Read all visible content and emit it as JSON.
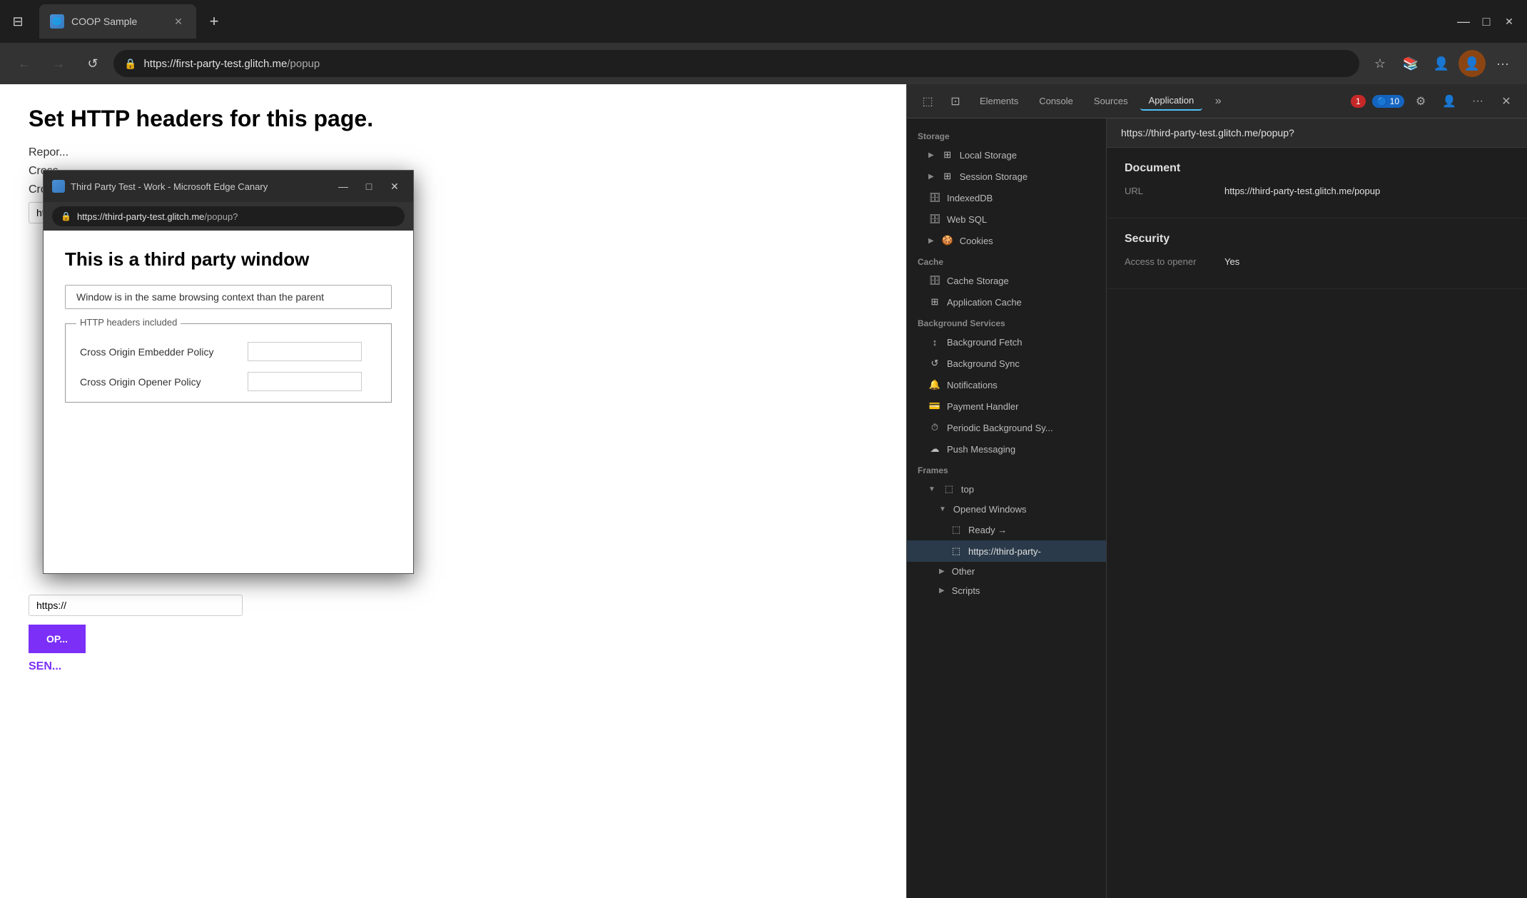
{
  "browser": {
    "tab_title": "COOP Sample",
    "tab_new_label": "+",
    "window_minimize": "—",
    "window_maximize": "□",
    "window_close": "✕",
    "nav_back": "←",
    "nav_forward": "→",
    "nav_reload": "↺",
    "address_protocol": "https://",
    "address_host": "first-party-test.glitch.me",
    "address_path": "/popup"
  },
  "page": {
    "title": "Set HTTP headers for this page.",
    "line1": "Repor...",
    "line2": "Cross...",
    "line3": "Cross...",
    "input_placeholder": "https://...",
    "button_label": "OP...",
    "send_label": "SEN..."
  },
  "popup": {
    "title": "Third Party Test - Work - Microsoft Edge Canary",
    "minimize": "—",
    "maximize": "□",
    "close": "✕",
    "address_protocol": "https://",
    "address_host": "third-party-test.glitch.me",
    "address_path": "/popup?",
    "heading": "This is a third party window",
    "info_box": "Window is in the same browsing context than the parent",
    "fieldset_legend": "HTTP headers included",
    "field1_label": "Cross Origin Embedder Policy",
    "field2_label": "Cross Origin Opener Policy",
    "field1_value": "",
    "field2_value": ""
  },
  "devtools": {
    "tool_inspector": "⬚",
    "tool_device": "⊡",
    "tabs": [
      {
        "label": "Elements",
        "active": false
      },
      {
        "label": "Console",
        "active": false
      },
      {
        "label": "Sources",
        "active": false
      },
      {
        "label": "Application",
        "active": true
      }
    ],
    "more_tabs": "»",
    "badge_red": "1",
    "badge_blue": "10",
    "gear": "⚙",
    "person": "👤",
    "ellipsis": "···",
    "close": "✕",
    "url_bar": "https://third-party-test.glitch.me/popup?",
    "sidebar": {
      "storage_label": "Storage",
      "local_storage": "Local Storage",
      "session_storage": "Session Storage",
      "indexed_db": "IndexedDB",
      "web_sql": "Web SQL",
      "cookies": "Cookies",
      "cache_label": "Cache",
      "cache_storage": "Cache Storage",
      "application_cache": "Application Cache",
      "background_services_label": "Background Services",
      "background_fetch": "Background Fetch",
      "background_sync": "Background Sync",
      "notifications": "Notifications",
      "payment_handler": "Payment Handler",
      "periodic_bg_sync": "Periodic Background Sy...",
      "push_messaging": "Push Messaging",
      "frames_label": "Frames",
      "frames_top": "top",
      "opened_windows": "Opened Windows",
      "ready": "Ready →",
      "third_party_url": "https://third-party-",
      "other": "Other",
      "scripts": "Scripts"
    },
    "main": {
      "document_section": "Document",
      "url_label": "URL",
      "url_value": "https://third-party-test.glitch.me/popup",
      "security_section": "Security",
      "access_to_opener_label": "Access to opener",
      "access_to_opener_value": "Yes"
    }
  }
}
